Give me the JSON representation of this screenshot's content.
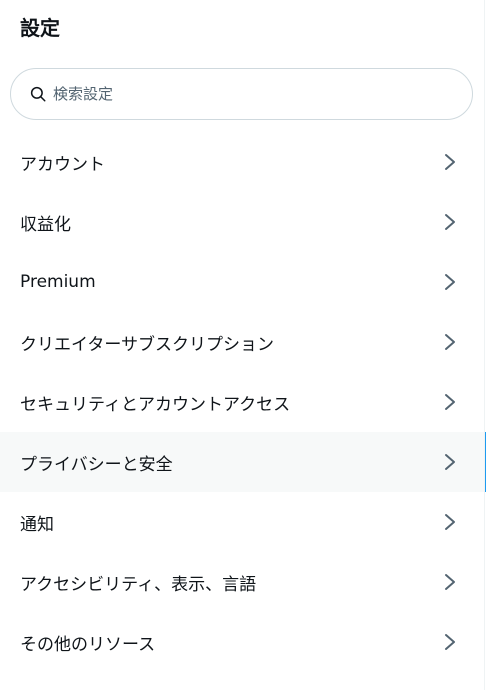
{
  "header": {
    "title": "設定"
  },
  "search": {
    "placeholder": "検索設定",
    "value": ""
  },
  "menu": {
    "items": [
      {
        "label": "アカウント",
        "active": false
      },
      {
        "label": "収益化",
        "active": false
      },
      {
        "label": "Premium",
        "active": false
      },
      {
        "label": "クリエイターサブスクリプション",
        "active": false
      },
      {
        "label": "セキュリティとアカウントアクセス",
        "active": false
      },
      {
        "label": "プライバシーと安全",
        "active": true
      },
      {
        "label": "通知",
        "active": false
      },
      {
        "label": "アクセシビリティ、表示、言語",
        "active": false
      },
      {
        "label": "その他のリソース",
        "active": false
      }
    ]
  },
  "icons": {
    "search": "search-icon",
    "chevron": "chevron-right-icon"
  },
  "colors": {
    "text": "#0f1419",
    "secondary_text": "#536471",
    "active_background": "#f7f9f9",
    "active_indicator": "#1d9bf0",
    "border": "#cfd9de"
  }
}
